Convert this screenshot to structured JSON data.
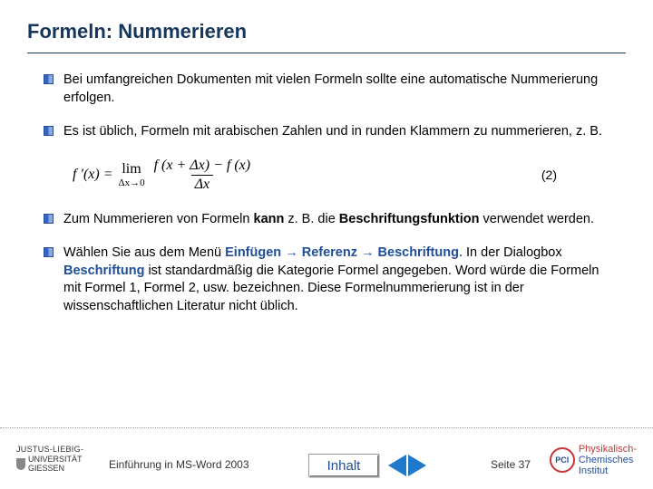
{
  "title": "Formeln: Nummerieren",
  "bullets": {
    "b1": "Bei umfangreichen Dokumenten mit vielen Formeln sollte eine automatische Nummerierung erfolgen.",
    "b2": "Es ist üblich, Formeln mit arabischen Zahlen und in runden Klammern zu nummerieren, z. B.",
    "b3_pre": "Zum Nummerieren von Formeln ",
    "b3_bold1": "kann",
    "b3_mid": " z. B. die ",
    "b3_bold2": "Beschriftungsfunktion",
    "b3_post": " verwendet werden.",
    "b4_pre": "Wählen Sie aus dem Menü ",
    "b4_m1": "Einfügen",
    "b4_arrow": " → ",
    "b4_m2": "Referenz",
    "b4_m3": "Beschriftung",
    "b4_post1": ". In der Dialogbox ",
    "b4_m4": "Beschriftung",
    "b4_post2": " ist standardmäßig die Kategorie Formel angegeben. Word würde die Formeln mit Formel 1, Formel 2, usw. bezeichnen. Diese Formelnummerierung ist in der wissenschaftlichen Literatur nicht üblich."
  },
  "formula": {
    "lhs": "f ′(x) =",
    "lim": "lim",
    "limsub": "Δx→0",
    "num": "f (x + Δx) − f (x)",
    "den": "Δx",
    "eqnum": "(2)"
  },
  "footer": {
    "uni1": "JUSTUS-LIEBIG-",
    "uni2": "UNIVERSITÄT",
    "uni3": "GIESSEN",
    "center": "Einführung in MS-Word 2003",
    "inhalt": "Inhalt",
    "page": "Seite 37",
    "inst1": "Physikalisch-",
    "inst2": "Chemisches",
    "inst3": "Institut",
    "instmark": "PCI"
  }
}
